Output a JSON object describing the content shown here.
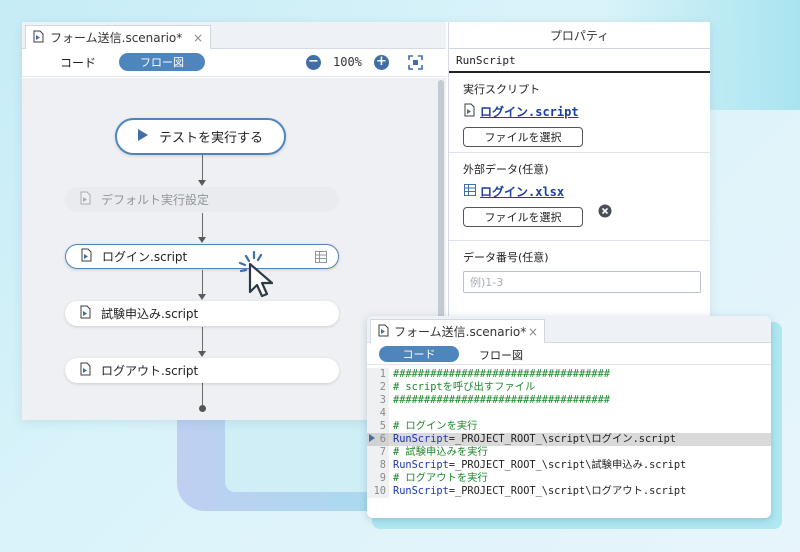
{
  "editor": {
    "tab_title": "フォーム送信.scenario*",
    "tab_close": "×",
    "mode_code": "コード",
    "mode_flow": "フロー図",
    "zoom": "100%",
    "zoom_out": "−",
    "zoom_in": "+"
  },
  "flow": {
    "start_label": "テストを実行する",
    "nodes": [
      {
        "label": "デフォルト実行設定",
        "state": "disabled"
      },
      {
        "label": "ログイン.script",
        "state": "selected"
      },
      {
        "label": "試験申込み.script",
        "state": "normal"
      },
      {
        "label": "ログアウト.script",
        "state": "normal"
      }
    ]
  },
  "properties": {
    "header": "プロパティ",
    "title": "RunScript",
    "script_label": "実行スクリプト",
    "script_file": "ログイン.script",
    "choose_file": "ファイルを選択",
    "external_label": "外部データ(任意)",
    "external_file": "ログイン.xlsx",
    "data_no_label": "データ番号(任意)",
    "data_no_placeholder": "例)1-3"
  },
  "code_editor": {
    "tab_title": "フォーム送信.scenario*",
    "tab_close": "×",
    "mode_code": "コード",
    "mode_flow": "フロー図",
    "lines": [
      {
        "n": "1",
        "kind": "comment",
        "text": "###################################"
      },
      {
        "n": "2",
        "kind": "comment",
        "text": "# scriptを呼び出すファイル"
      },
      {
        "n": "3",
        "kind": "comment",
        "text": "###################################"
      },
      {
        "n": "4",
        "kind": "blank",
        "text": ""
      },
      {
        "n": "5",
        "kind": "comment",
        "text": "# ログインを実行"
      },
      {
        "n": "6",
        "kind": "call",
        "fn": "RunScript",
        "text": "=_PROJECT_ROOT_\\script\\ログイン.script",
        "active": true
      },
      {
        "n": "7",
        "kind": "comment",
        "text": "# 試験申込みを実行"
      },
      {
        "n": "8",
        "kind": "call",
        "fn": "RunScript",
        "text": "=_PROJECT_ROOT_\\script\\試験申込み.script"
      },
      {
        "n": "9",
        "kind": "comment",
        "text": "# ログアウトを実行"
      },
      {
        "n": "10",
        "kind": "call",
        "fn": "RunScript",
        "text": "=_PROJECT_ROOT_\\script\\ログアウト.script"
      }
    ]
  },
  "colors": {
    "accent": "#4f85bd",
    "link": "#1b3fa0",
    "comment": "#1e8a2e",
    "function": "#1b35b3"
  }
}
